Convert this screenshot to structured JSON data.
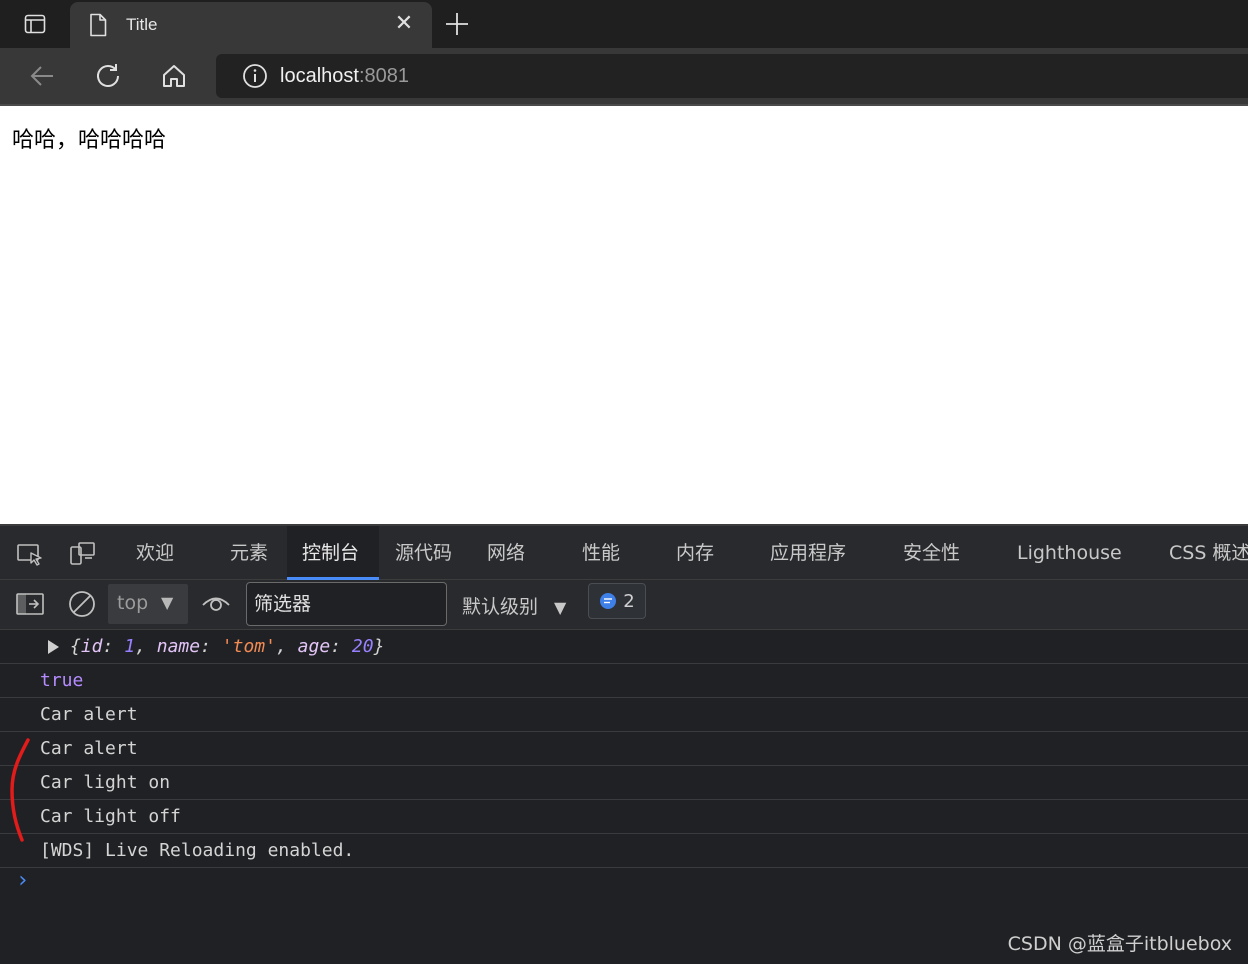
{
  "browser": {
    "tab_title": "Title",
    "url_host": "localhost",
    "url_port": ":8081"
  },
  "page": {
    "content_text": "哈哈，哈哈哈哈"
  },
  "devtools": {
    "tabs": [
      "欢迎",
      "元素",
      "控制台",
      "源代码",
      "网络",
      "性能",
      "内存",
      "应用程序",
      "安全性",
      "Lighthouse",
      "CSS 概述"
    ],
    "active_tab": "控制台",
    "context": "top",
    "filter_placeholder": "筛选器",
    "level_label": "默认级别",
    "message_count": "2"
  },
  "console": {
    "object_line": {
      "id_key": "id",
      "id_val": "1",
      "name_key": "name",
      "name_val": "'tom'",
      "age_key": "age",
      "age_val": "20"
    },
    "logs": [
      "true",
      "Car alert",
      "Car alert",
      "Car light on",
      "Car light off",
      "[WDS] Live Reloading enabled."
    ],
    "prompt": "›"
  },
  "watermark": "CSDN @蓝盒子itbluebox",
  "colors": {
    "accent": "#4a8cf7",
    "console_bg": "#202124",
    "annotation": "#e21b1b"
  }
}
